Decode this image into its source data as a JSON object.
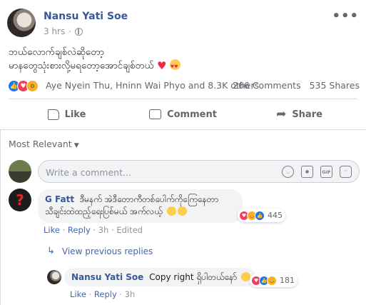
{
  "post": {
    "author": "Nansu Yati Soe",
    "time": "3 hrs",
    "separator": "·",
    "more_label": "•••",
    "text_line1": "ဘယ်လောက်ချစ်လဲဆိုတော့",
    "text_line2": "မာနတွေသုံးစားလို့မရတော့အောင်ချစ်တယ်",
    "reactions": {
      "types": [
        "like",
        "love",
        "wow"
      ],
      "names": "Aye Nyein Thu, Hninn Wai Phyo and 8.3K others",
      "comments": "266 Comments",
      "shares": "535 Shares"
    },
    "actions": {
      "like": "Like",
      "comment": "Comment",
      "share": "Share"
    }
  },
  "comments": {
    "sort_label": "Most Relevant",
    "compose_placeholder": "Write a comment...",
    "compose_icons": [
      "emoji-icon",
      "camera-icon",
      "gif-icon",
      "sticker-icon"
    ],
    "gif_label": "GIF",
    "items": [
      {
        "author": "G Fatt",
        "text": "ဒီမနက် အဲဒီတောကီတစ်ပေါက်ကိုကြေနေတာ သီချင်းထဲထည့်ရေးပြစ်မယ် အက်လယ့်",
        "reaction_count": "445",
        "like": "Like",
        "reply": "Reply",
        "time": "3h",
        "edited": "Edited"
      }
    ],
    "view_previous": "View previous replies",
    "reply": {
      "author": "Nansu Yati Soe",
      "text": "Copy right ရှိပါတယ်နော်",
      "reaction_count": "181",
      "like": "Like",
      "reply": "Reply",
      "time": "3h"
    }
  },
  "colors": {
    "link_blue": "#385898",
    "accent_blue": "#4267b2",
    "muted_gray": "#606770",
    "love_red": "#f33e58",
    "like_blue": "#1877f2"
  }
}
